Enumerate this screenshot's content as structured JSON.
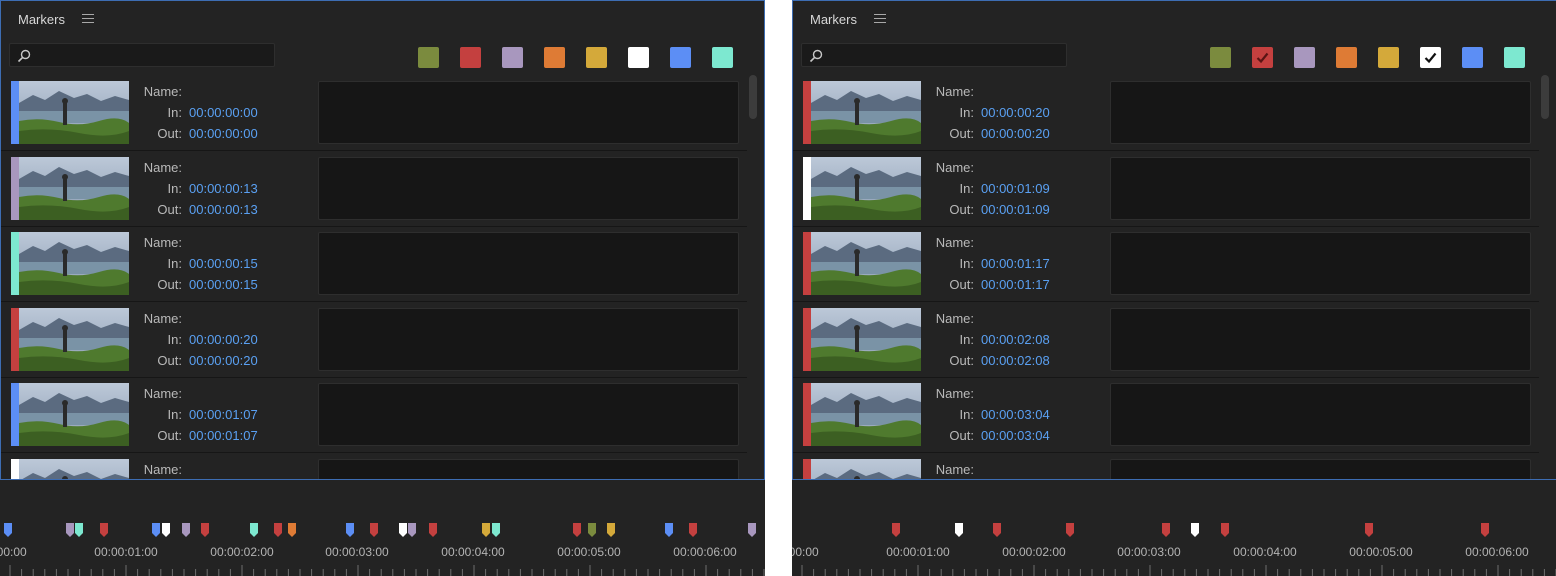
{
  "palette": {
    "green": "#7b8b3e",
    "red": "#c4403f",
    "violet": "#a897be",
    "orange": "#de7b35",
    "yellow": "#d4a93a",
    "white": "#ffffff",
    "blue": "#5c8ef5",
    "teal": "#7de8d0"
  },
  "color_order": [
    "green",
    "red",
    "violet",
    "orange",
    "yellow",
    "white",
    "blue",
    "teal"
  ],
  "labels": {
    "name": "Name:",
    "in": "In:",
    "out": "Out:"
  },
  "panels": [
    {
      "title": "Markers",
      "search": {
        "value": "",
        "placeholder": ""
      },
      "filters_checked": [],
      "markers": [
        {
          "color": "blue",
          "in": "00:00:00:00",
          "out": "00:00:00:00"
        },
        {
          "color": "violet",
          "in": "00:00:00:13",
          "out": "00:00:00:13"
        },
        {
          "color": "teal",
          "in": "00:00:00:15",
          "out": "00:00:00:15"
        },
        {
          "color": "red",
          "in": "00:00:00:20",
          "out": "00:00:00:20"
        },
        {
          "color": "blue",
          "in": "00:00:01:07",
          "out": "00:00:01:07"
        },
        {
          "color": "white",
          "in": "",
          "out": ""
        }
      ],
      "timeline": {
        "labels": [
          ":00:00",
          "00:00:01:00",
          "00:00:02:00",
          "00:00:03:00",
          "00:00:04:00",
          "00:00:05:00",
          "00:00:06:00"
        ],
        "markers": [
          "blue",
          "violet",
          "teal",
          "red",
          "blue",
          "white",
          "violet",
          "red",
          "teal",
          "red",
          "orange",
          "blue",
          "red",
          "white",
          "violet",
          "red",
          "yellow",
          "teal",
          "red",
          "green",
          "yellow",
          "blue",
          "red",
          "violet"
        ]
      }
    },
    {
      "title": "Markers",
      "search": {
        "value": "",
        "placeholder": ""
      },
      "filters_checked": [
        "red",
        "white"
      ],
      "markers": [
        {
          "color": "red",
          "in": "00:00:00:20",
          "out": "00:00:00:20"
        },
        {
          "color": "white",
          "in": "00:00:01:09",
          "out": "00:00:01:09"
        },
        {
          "color": "red",
          "in": "00:00:01:17",
          "out": "00:00:01:17"
        },
        {
          "color": "red",
          "in": "00:00:02:08",
          "out": "00:00:02:08"
        },
        {
          "color": "red",
          "in": "00:00:03:04",
          "out": "00:00:03:04"
        },
        {
          "color": "red",
          "in": "",
          "out": ""
        }
      ],
      "timeline": {
        "labels": [
          ":00:00",
          "00:00:01:00",
          "00:00:02:00",
          "00:00:03:00",
          "00:00:04:00",
          "00:00:05:00",
          "00:00:06:00"
        ],
        "markers": [
          "red",
          "white",
          "red",
          "red",
          "red",
          "white",
          "red",
          "red",
          "red"
        ]
      }
    }
  ]
}
